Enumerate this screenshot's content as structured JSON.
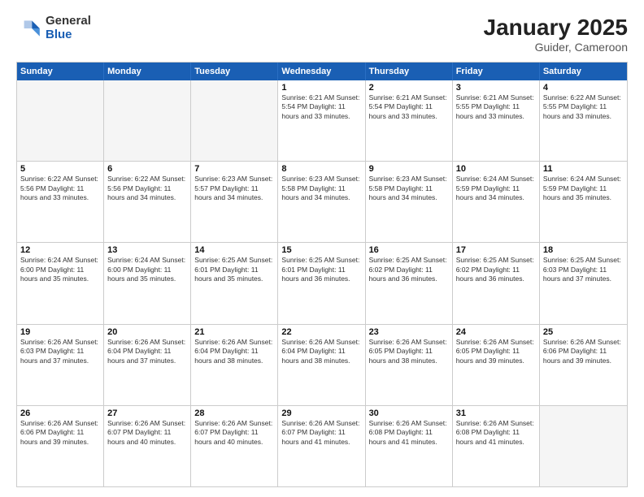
{
  "logo": {
    "general": "General",
    "blue": "Blue"
  },
  "title": "January 2025",
  "subtitle": "Guider, Cameroon",
  "header_days": [
    "Sunday",
    "Monday",
    "Tuesday",
    "Wednesday",
    "Thursday",
    "Friday",
    "Saturday"
  ],
  "weeks": [
    [
      {
        "day": "",
        "info": "",
        "empty": true
      },
      {
        "day": "",
        "info": "",
        "empty": true
      },
      {
        "day": "",
        "info": "",
        "empty": true
      },
      {
        "day": "1",
        "info": "Sunrise: 6:21 AM\nSunset: 5:54 PM\nDaylight: 11 hours\nand 33 minutes."
      },
      {
        "day": "2",
        "info": "Sunrise: 6:21 AM\nSunset: 5:54 PM\nDaylight: 11 hours\nand 33 minutes."
      },
      {
        "day": "3",
        "info": "Sunrise: 6:21 AM\nSunset: 5:55 PM\nDaylight: 11 hours\nand 33 minutes."
      },
      {
        "day": "4",
        "info": "Sunrise: 6:22 AM\nSunset: 5:55 PM\nDaylight: 11 hours\nand 33 minutes."
      }
    ],
    [
      {
        "day": "5",
        "info": "Sunrise: 6:22 AM\nSunset: 5:56 PM\nDaylight: 11 hours\nand 33 minutes."
      },
      {
        "day": "6",
        "info": "Sunrise: 6:22 AM\nSunset: 5:56 PM\nDaylight: 11 hours\nand 34 minutes."
      },
      {
        "day": "7",
        "info": "Sunrise: 6:23 AM\nSunset: 5:57 PM\nDaylight: 11 hours\nand 34 minutes."
      },
      {
        "day": "8",
        "info": "Sunrise: 6:23 AM\nSunset: 5:58 PM\nDaylight: 11 hours\nand 34 minutes."
      },
      {
        "day": "9",
        "info": "Sunrise: 6:23 AM\nSunset: 5:58 PM\nDaylight: 11 hours\nand 34 minutes."
      },
      {
        "day": "10",
        "info": "Sunrise: 6:24 AM\nSunset: 5:59 PM\nDaylight: 11 hours\nand 34 minutes."
      },
      {
        "day": "11",
        "info": "Sunrise: 6:24 AM\nSunset: 5:59 PM\nDaylight: 11 hours\nand 35 minutes."
      }
    ],
    [
      {
        "day": "12",
        "info": "Sunrise: 6:24 AM\nSunset: 6:00 PM\nDaylight: 11 hours\nand 35 minutes."
      },
      {
        "day": "13",
        "info": "Sunrise: 6:24 AM\nSunset: 6:00 PM\nDaylight: 11 hours\nand 35 minutes."
      },
      {
        "day": "14",
        "info": "Sunrise: 6:25 AM\nSunset: 6:01 PM\nDaylight: 11 hours\nand 35 minutes."
      },
      {
        "day": "15",
        "info": "Sunrise: 6:25 AM\nSunset: 6:01 PM\nDaylight: 11 hours\nand 36 minutes."
      },
      {
        "day": "16",
        "info": "Sunrise: 6:25 AM\nSunset: 6:02 PM\nDaylight: 11 hours\nand 36 minutes."
      },
      {
        "day": "17",
        "info": "Sunrise: 6:25 AM\nSunset: 6:02 PM\nDaylight: 11 hours\nand 36 minutes."
      },
      {
        "day": "18",
        "info": "Sunrise: 6:25 AM\nSunset: 6:03 PM\nDaylight: 11 hours\nand 37 minutes."
      }
    ],
    [
      {
        "day": "19",
        "info": "Sunrise: 6:26 AM\nSunset: 6:03 PM\nDaylight: 11 hours\nand 37 minutes."
      },
      {
        "day": "20",
        "info": "Sunrise: 6:26 AM\nSunset: 6:04 PM\nDaylight: 11 hours\nand 37 minutes."
      },
      {
        "day": "21",
        "info": "Sunrise: 6:26 AM\nSunset: 6:04 PM\nDaylight: 11 hours\nand 38 minutes."
      },
      {
        "day": "22",
        "info": "Sunrise: 6:26 AM\nSunset: 6:04 PM\nDaylight: 11 hours\nand 38 minutes."
      },
      {
        "day": "23",
        "info": "Sunrise: 6:26 AM\nSunset: 6:05 PM\nDaylight: 11 hours\nand 38 minutes."
      },
      {
        "day": "24",
        "info": "Sunrise: 6:26 AM\nSunset: 6:05 PM\nDaylight: 11 hours\nand 39 minutes."
      },
      {
        "day": "25",
        "info": "Sunrise: 6:26 AM\nSunset: 6:06 PM\nDaylight: 11 hours\nand 39 minutes."
      }
    ],
    [
      {
        "day": "26",
        "info": "Sunrise: 6:26 AM\nSunset: 6:06 PM\nDaylight: 11 hours\nand 39 minutes."
      },
      {
        "day": "27",
        "info": "Sunrise: 6:26 AM\nSunset: 6:07 PM\nDaylight: 11 hours\nand 40 minutes."
      },
      {
        "day": "28",
        "info": "Sunrise: 6:26 AM\nSunset: 6:07 PM\nDaylight: 11 hours\nand 40 minutes."
      },
      {
        "day": "29",
        "info": "Sunrise: 6:26 AM\nSunset: 6:07 PM\nDaylight: 11 hours\nand 41 minutes."
      },
      {
        "day": "30",
        "info": "Sunrise: 6:26 AM\nSunset: 6:08 PM\nDaylight: 11 hours\nand 41 minutes."
      },
      {
        "day": "31",
        "info": "Sunrise: 6:26 AM\nSunset: 6:08 PM\nDaylight: 11 hours\nand 41 minutes."
      },
      {
        "day": "",
        "info": "",
        "empty": true
      }
    ]
  ]
}
